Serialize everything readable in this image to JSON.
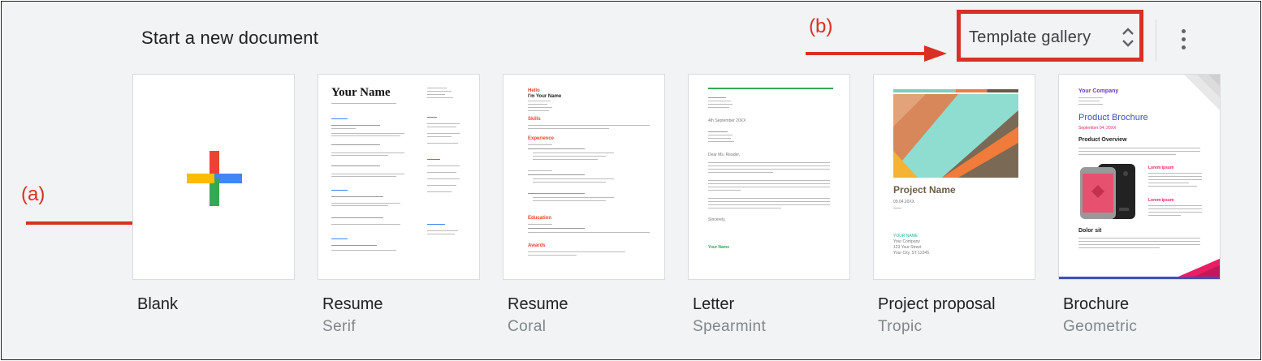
{
  "header": {
    "title": "Start a new document"
  },
  "toolbar": {
    "template_gallery_label": "Template gallery"
  },
  "annotations": {
    "a": "(a)",
    "b": "(b)"
  },
  "templates": [
    {
      "name": "Blank",
      "subtitle": ""
    },
    {
      "name": "Resume",
      "subtitle": "Serif"
    },
    {
      "name": "Resume",
      "subtitle": "Coral"
    },
    {
      "name": "Letter",
      "subtitle": "Spearmint"
    },
    {
      "name": "Project proposal",
      "subtitle": "Tropic"
    },
    {
      "name": "Brochure",
      "subtitle": "Geometric"
    }
  ],
  "previews": {
    "serif_name": "Your Name",
    "coral_greeting": "Hello",
    "coral_name": "I'm Your Name",
    "coral_skills": "Skills",
    "coral_experience": "Experience",
    "coral_education": "Education",
    "coral_awards": "Awards",
    "letter_date": "4th September 20XX",
    "letter_greeting": "Dear Ms. Reader,",
    "letter_sign": "Sincerely,",
    "letter_name": "Your Name",
    "proposal_title": "Project Name",
    "proposal_date": "09.04.20XX",
    "proposal_author": "YOUR NAME",
    "proposal_company": "Your Company",
    "proposal_street": "123 Your Street",
    "proposal_city": "Your City, ST 12345",
    "brochure_company": "Your Company",
    "brochure_title": "Product Brochure",
    "brochure_date": "September 04, 20XX",
    "brochure_overview": "Product Overview",
    "brochure_lorem": "Lorem ipsum",
    "brochure_dolor": "Dolor sit"
  },
  "colors": {
    "accent_red": "#d93025",
    "google_blue": "#4285f4",
    "google_red": "#ea4335",
    "google_yellow": "#fbbc04",
    "google_green": "#34a853"
  }
}
